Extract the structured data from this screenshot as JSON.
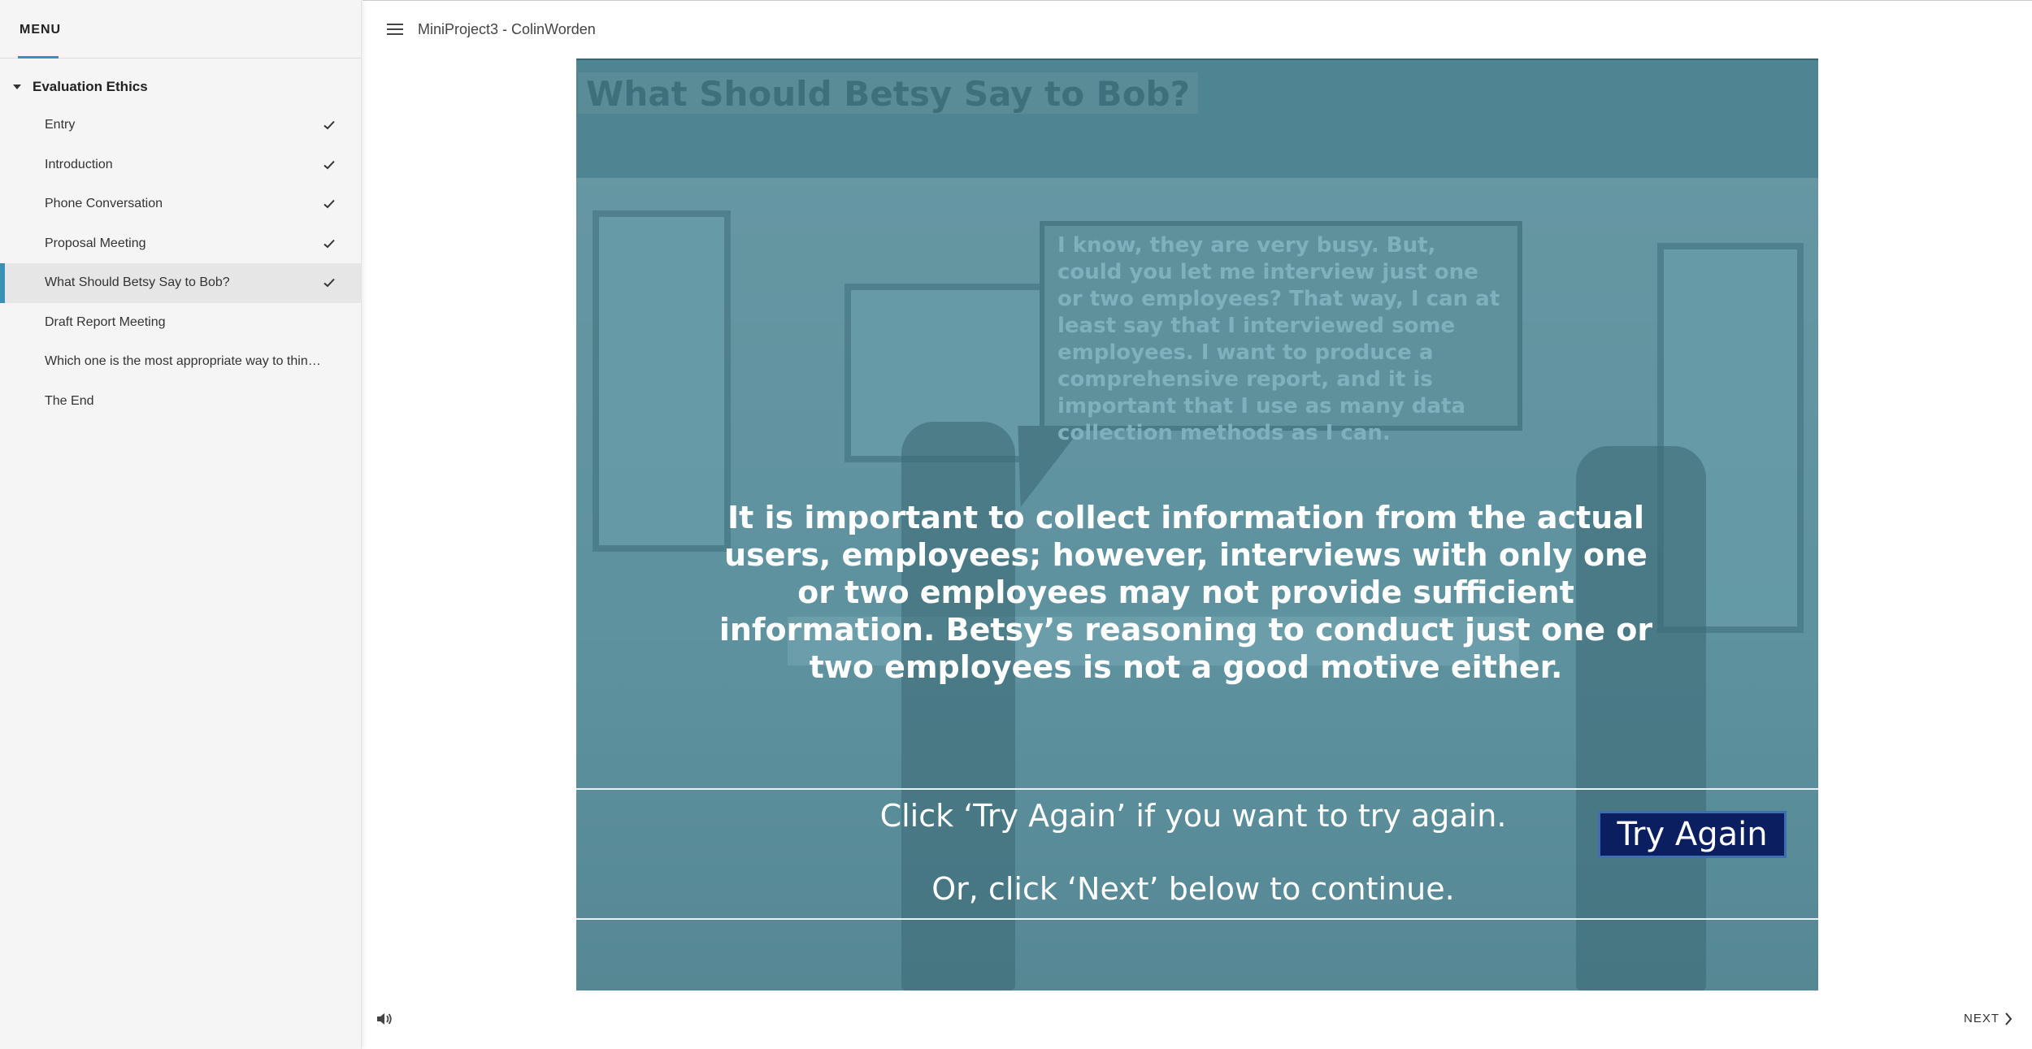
{
  "sidebar": {
    "menu_title": "MENU",
    "section_title": "Evaluation Ethics",
    "items": [
      {
        "label": "Entry",
        "completed": true
      },
      {
        "label": "Introduction",
        "completed": true
      },
      {
        "label": "Phone Conversation",
        "completed": true
      },
      {
        "label": "Proposal Meeting",
        "completed": true
      },
      {
        "label": "What Should Betsy Say to Bob?",
        "completed": true,
        "active": true
      },
      {
        "label": "Draft Report Meeting",
        "completed": false
      },
      {
        "label": "Which one is the most appropriate way to thin…",
        "completed": false
      },
      {
        "label": "The End",
        "completed": false
      }
    ]
  },
  "header": {
    "course_title": "MiniProject3 - ColinWorden",
    "menu_icon": "hamburger-icon"
  },
  "slide": {
    "title": "What Should Betsy Say to Bob?",
    "bubble_text": "I know, they are very busy. But, could you let me interview just one or two employees? That way, I can at least say that I interviewed some employees. I want to produce a comprehensive report, and it is important that I use as many data collection methods as I can.",
    "feedback_text": "It is important to collect information from the actual users, employees; however, interviews with only one or two employees may not provide sufficient information. Betsy’s reasoning to conduct just one or two employees is not a good motive either.",
    "instruction_1": "Click ‘Try Again’ if you want to try again.",
    "instruction_2": "Or, click ‘Next’ below to continue.",
    "try_again_label": "Try Again"
  },
  "footer": {
    "next_label": "NEXT",
    "audio_icon": "speaker-icon"
  },
  "colors": {
    "accent": "#3c8fb5",
    "slide_bg": "#4f8593",
    "button_bg": "#0b1e5f"
  }
}
